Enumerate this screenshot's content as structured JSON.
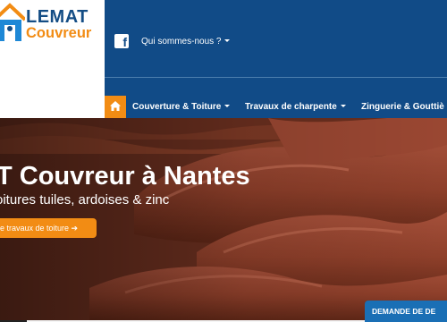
{
  "logo": {
    "line1": "LEMAT",
    "line2": "Couvreur"
  },
  "topbar": {
    "social_icon": "facebook-icon",
    "link": "Qui sommes-nous ?"
  },
  "nav": {
    "home_icon": "home-icon",
    "items": [
      {
        "label": "Couverture & Toiture"
      },
      {
        "label": "Travaux de charpente"
      },
      {
        "label": "Zinguerie & Gouttiè"
      }
    ]
  },
  "hero": {
    "title": "T Couvreur à Nantes",
    "subtitle": "oitures tuiles, ardoises & zinc",
    "cta": "e travaux de toiture ➔"
  },
  "devis": {
    "label": "DEMANDE DE DE"
  },
  "colors": {
    "brand_blue": "#114b87",
    "accent_orange": "#f28c14",
    "tab_blue": "#1a6fb5"
  }
}
